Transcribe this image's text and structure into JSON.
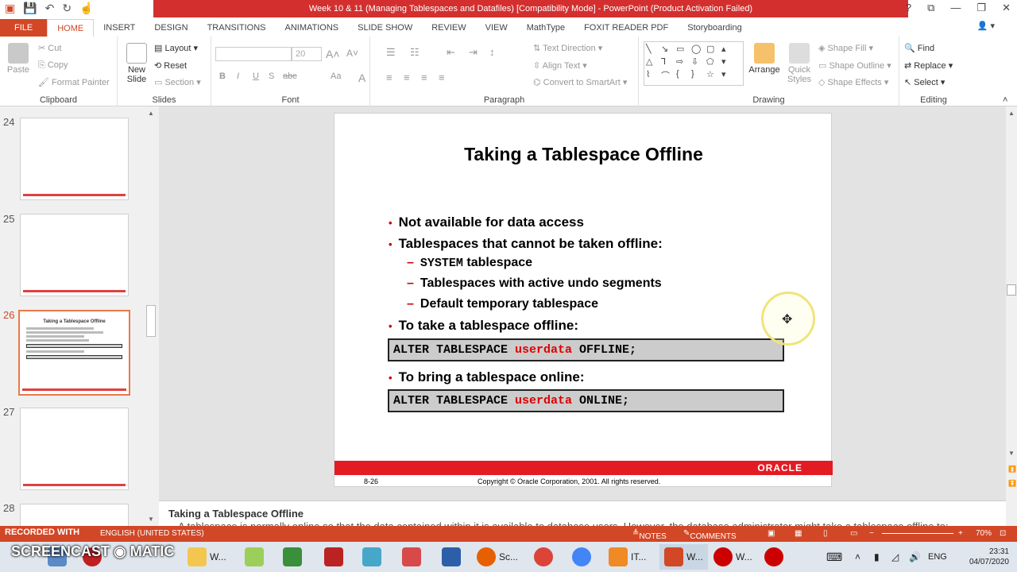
{
  "window": {
    "title": "Week 10 & 11 (Managing Tablespaces and Datafiles) [Compatibility Mode] - PowerPoint (Product Activation Failed)"
  },
  "ribbon_tabs": [
    "FILE",
    "HOME",
    "INSERT",
    "DESIGN",
    "TRANSITIONS",
    "ANIMATIONS",
    "SLIDE SHOW",
    "REVIEW",
    "VIEW",
    "MathType",
    "FOXIT READER PDF",
    "Storyboarding"
  ],
  "clipboard": {
    "paste": "Paste",
    "cut": "Cut",
    "copy": "Copy",
    "format_painter": "Format Painter",
    "label": "Clipboard"
  },
  "slides_group": {
    "new_slide": "New Slide",
    "layout": "Layout",
    "reset": "Reset",
    "section": "Section",
    "label": "Slides"
  },
  "font_group": {
    "size": "20",
    "label": "Font",
    "bold": "B",
    "italic": "I",
    "underline": "U",
    "shadow": "S",
    "strike": "abc",
    "case": "Aa",
    "color": "A"
  },
  "paragraph_group": {
    "text_direction": "Text Direction",
    "align_text": "Align Text",
    "convert": "Convert to SmartArt",
    "label": "Paragraph"
  },
  "drawing_group": {
    "arrange": "Arrange",
    "quick_styles": "Quick Styles",
    "shape_fill": "Shape Fill",
    "shape_outline": "Shape Outline",
    "shape_effects": "Shape Effects",
    "label": "Drawing"
  },
  "editing_group": {
    "find": "Find",
    "replace": "Replace",
    "select": "Select",
    "label": "Editing"
  },
  "thumbnails": [
    {
      "num": "24"
    },
    {
      "num": "25"
    },
    {
      "num": "26",
      "mini_title": "Taking a Tablespace Offline"
    },
    {
      "num": "27"
    },
    {
      "num": "28"
    }
  ],
  "slide": {
    "title": "Taking a Tablespace Offline",
    "b1": "Not available for data access",
    "b2": "Tablespaces that cannot be taken offline:",
    "s1_mono": "SYSTEM",
    "s1_rest": " tablespace",
    "s2": "Tablespaces with active undo segments",
    "s3": "Default temporary tablespace",
    "b3": "To take a tablespace offline:",
    "code1_pre": "ALTER TABLESPACE ",
    "code1_red": "userdata",
    "code1_post": " OFFLINE;",
    "b4": "To bring a tablespace online:",
    "code2_pre": "ALTER TABLESPACE ",
    "code2_red": "userdata",
    "code2_post": " ONLINE;",
    "oracle": "ORACLE",
    "page": "8-26",
    "copyright": "Copyright © Oracle Corporation, 2001. All rights reserved."
  },
  "notes": {
    "title": "Taking a Tablespace Offline",
    "body": "A tablespace is normally online so that the data contained within it is available to database users. However, the database administrator might take a tablespace offline to:"
  },
  "status": {
    "recorded": "RECORDED WITH",
    "language": "ENGLISH (UNITED STATES)",
    "notes": "NOTES",
    "comments": "COMMENTS",
    "zoom": "70%"
  },
  "watermark": "SCREENCAST ◉ MATIC",
  "taskbar": {
    "items": [
      {
        "label": "W..."
      },
      {
        "label": "Sc..."
      },
      {
        "label": "IT..."
      },
      {
        "label": "W..."
      },
      {
        "label": "W..."
      }
    ],
    "lang": "ENG",
    "time": "23:31",
    "date": "04/07/2020"
  }
}
